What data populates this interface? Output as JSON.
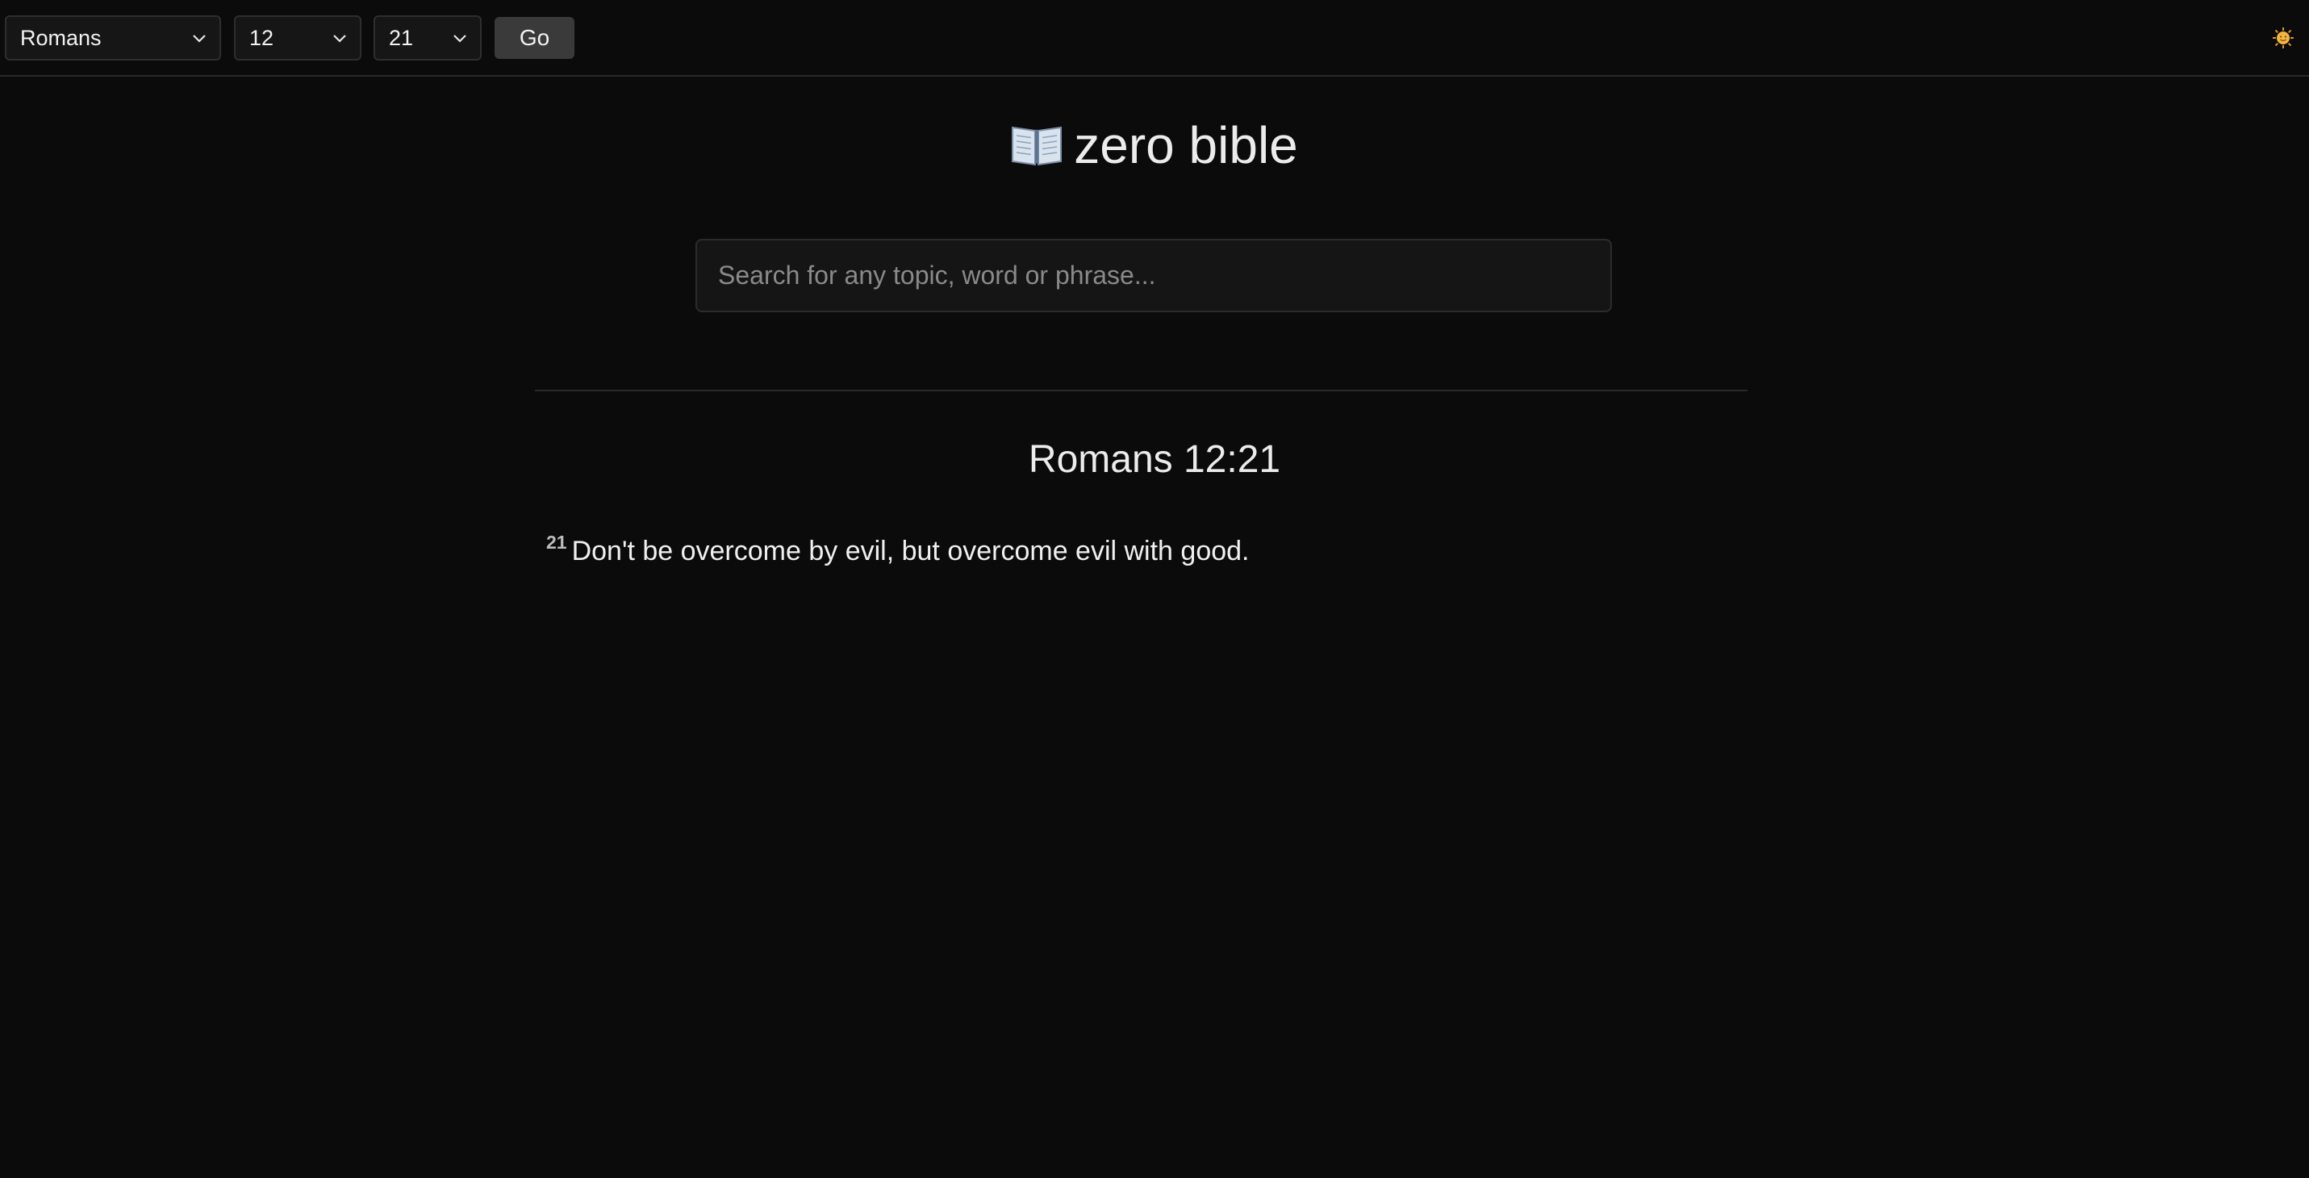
{
  "nav": {
    "book": "Romans",
    "chapter": "12",
    "verse": "21",
    "go_label": "Go",
    "theme_icon": "sun-emoji-icon"
  },
  "header": {
    "icon": "open-book-icon",
    "title": "zero bible"
  },
  "search": {
    "placeholder": "Search for any topic, word or phrase..."
  },
  "passage": {
    "reference": "Romans 12:21",
    "verses": [
      {
        "number": "21",
        "text": "Don't be overcome by evil, but overcome evil with good."
      }
    ]
  },
  "colors": {
    "background": "#0b0b0b",
    "button": "#3a3a3a",
    "accent": "#e0a83a"
  }
}
